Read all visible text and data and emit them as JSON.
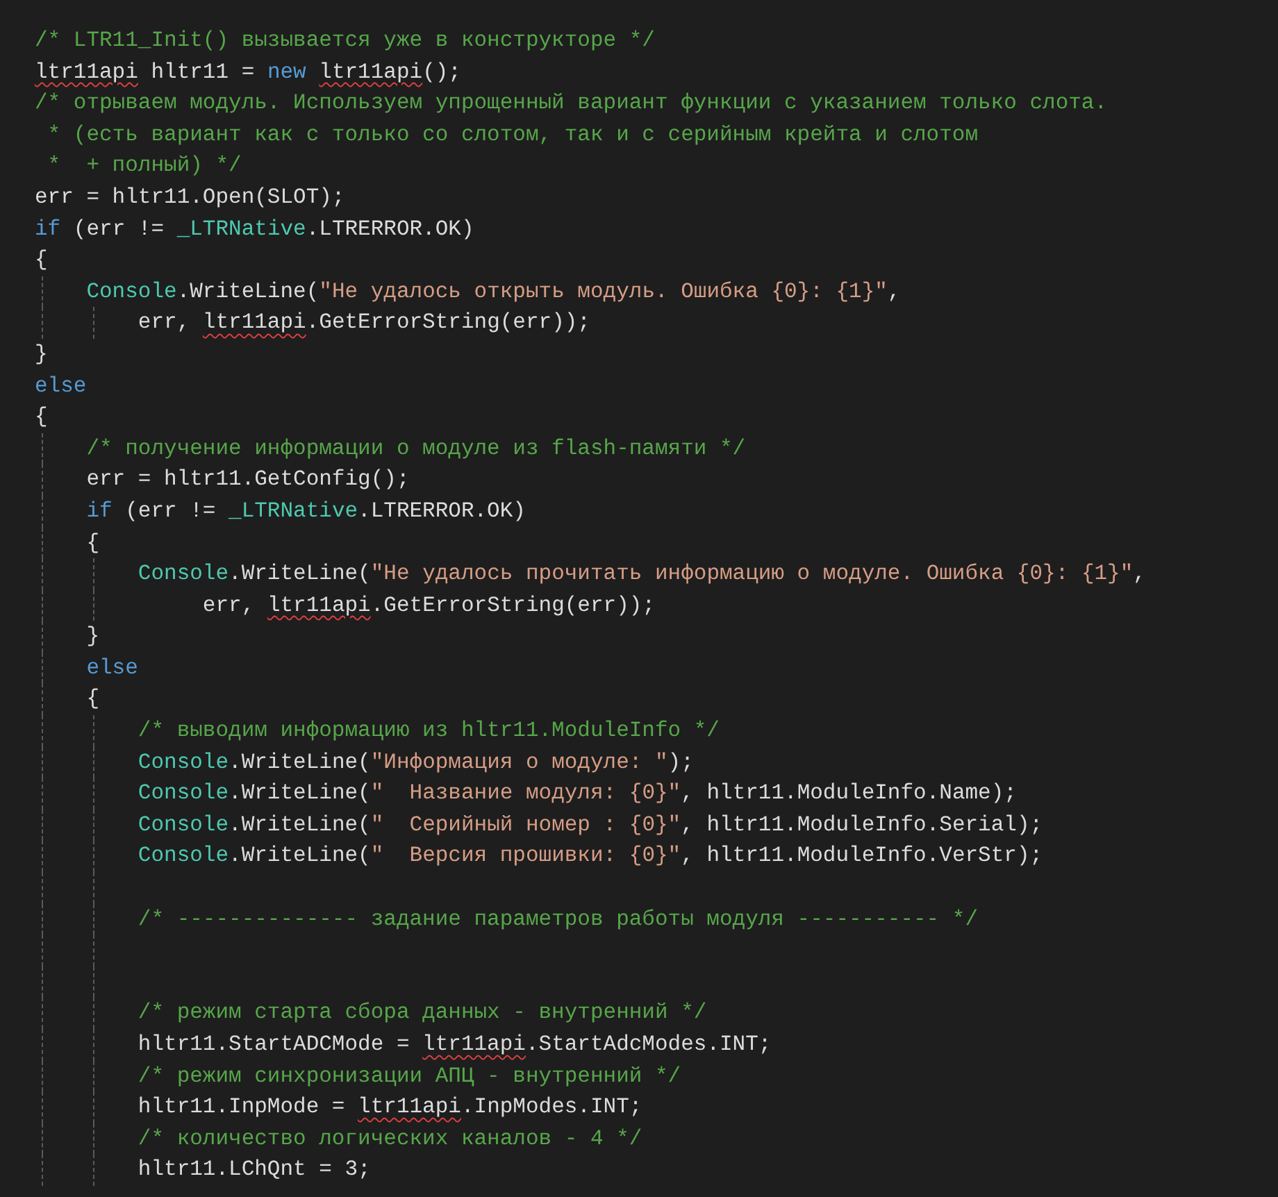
{
  "editor": {
    "lines": [
      {
        "kind": "code",
        "tokens": [
          {
            "kind": "comment",
            "text": "/* LTR11_Init() вызывается уже в конструкторе */"
          }
        ]
      },
      {
        "kind": "code",
        "tokens": [
          {
            "kind": "plain",
            "text": "ltr11api",
            "error": true
          },
          {
            "kind": "plain",
            "text": " hltr11 = "
          },
          {
            "kind": "keyword",
            "text": "new "
          },
          {
            "kind": "plain",
            "text": "ltr11api",
            "error": true
          },
          {
            "kind": "plain",
            "text": "();"
          }
        ]
      },
      {
        "kind": "code",
        "tokens": [
          {
            "kind": "comment",
            "text": "/* отрываем модуль. Используем упрощенный вариант функции с указанием только слота."
          }
        ]
      },
      {
        "kind": "code",
        "tokens": [
          {
            "kind": "comment",
            "text": " * (есть вариант как с только со слотом, так и с серийным крейта и слотом"
          }
        ]
      },
      {
        "kind": "code",
        "tokens": [
          {
            "kind": "comment",
            "text": " *  + полный) */"
          }
        ]
      },
      {
        "kind": "code",
        "tokens": [
          {
            "kind": "plain",
            "text": "err = hltr11.Open(SLOT);"
          }
        ]
      },
      {
        "kind": "code",
        "tokens": [
          {
            "kind": "keyword",
            "text": "if"
          },
          {
            "kind": "plain",
            "text": " (err != "
          },
          {
            "kind": "type",
            "text": "_LTRNative"
          },
          {
            "kind": "plain",
            "text": ".LTRERROR.OK)"
          }
        ]
      },
      {
        "kind": "code",
        "tokens": [
          {
            "kind": "plain",
            "text": "{"
          }
        ]
      },
      {
        "kind": "code",
        "tokens": [
          {
            "kind": "type",
            "text": "    Console"
          },
          {
            "kind": "plain",
            "text": ".WriteLine("
          },
          {
            "kind": "string",
            "text": "\"Не удалось открыть модуль. Ошибка {0}: {1}\""
          },
          {
            "kind": "plain",
            "text": ","
          }
        ]
      },
      {
        "kind": "code",
        "tokens": [
          {
            "kind": "plain",
            "text": "        err, "
          },
          {
            "kind": "plain",
            "text": "ltr11api",
            "error": true
          },
          {
            "kind": "plain",
            "text": ".GetErrorString(err));"
          }
        ]
      },
      {
        "kind": "code",
        "tokens": [
          {
            "kind": "plain",
            "text": "}"
          }
        ]
      },
      {
        "kind": "code",
        "tokens": [
          {
            "kind": "keyword",
            "text": "else"
          }
        ]
      },
      {
        "kind": "code",
        "tokens": [
          {
            "kind": "plain",
            "text": "{"
          }
        ]
      },
      {
        "kind": "code",
        "tokens": [
          {
            "kind": "comment",
            "text": "    /* получение информации о модуле из flash-памяти */"
          }
        ]
      },
      {
        "kind": "code",
        "tokens": [
          {
            "kind": "plain",
            "text": "    err = hltr11.GetConfig();"
          }
        ]
      },
      {
        "kind": "code",
        "tokens": [
          {
            "kind": "keyword",
            "text": "    if"
          },
          {
            "kind": "plain",
            "text": " (err != "
          },
          {
            "kind": "type",
            "text": "_LTRNative"
          },
          {
            "kind": "plain",
            "text": ".LTRERROR.OK)"
          }
        ]
      },
      {
        "kind": "code",
        "tokens": [
          {
            "kind": "plain",
            "text": "    {"
          }
        ]
      },
      {
        "kind": "code",
        "tokens": [
          {
            "kind": "type",
            "text": "        Console"
          },
          {
            "kind": "plain",
            "text": ".WriteLine("
          },
          {
            "kind": "string",
            "text": "\"Не удалось прочитать информацию о модуле. Ошибка {0}: {1}\""
          },
          {
            "kind": "plain",
            "text": ","
          }
        ]
      },
      {
        "kind": "code",
        "tokens": [
          {
            "kind": "plain",
            "text": "             err, "
          },
          {
            "kind": "plain",
            "text": "ltr11api",
            "error": true
          },
          {
            "kind": "plain",
            "text": ".GetErrorString(err));"
          }
        ]
      },
      {
        "kind": "code",
        "tokens": [
          {
            "kind": "plain",
            "text": "    }"
          }
        ]
      },
      {
        "kind": "code",
        "tokens": [
          {
            "kind": "keyword",
            "text": "    else"
          }
        ]
      },
      {
        "kind": "code",
        "tokens": [
          {
            "kind": "plain",
            "text": "    {"
          }
        ]
      },
      {
        "kind": "code",
        "tokens": [
          {
            "kind": "comment",
            "text": "        /* выводим информацию из hltr11.ModuleInfo */"
          }
        ]
      },
      {
        "kind": "code",
        "tokens": [
          {
            "kind": "type",
            "text": "        Console"
          },
          {
            "kind": "plain",
            "text": ".WriteLine("
          },
          {
            "kind": "string",
            "text": "\"Информация о модуле: \""
          },
          {
            "kind": "plain",
            "text": ");"
          }
        ]
      },
      {
        "kind": "code",
        "tokens": [
          {
            "kind": "type",
            "text": "        Console"
          },
          {
            "kind": "plain",
            "text": ".WriteLine("
          },
          {
            "kind": "string",
            "text": "\"  Название модуля: {0}\""
          },
          {
            "kind": "plain",
            "text": ", hltr11.ModuleInfo.Name);"
          }
        ]
      },
      {
        "kind": "code",
        "tokens": [
          {
            "kind": "type",
            "text": "        Console"
          },
          {
            "kind": "plain",
            "text": ".WriteLine("
          },
          {
            "kind": "string",
            "text": "\"  Серийный номер : {0}\""
          },
          {
            "kind": "plain",
            "text": ", hltr11.ModuleInfo.Serial);"
          }
        ]
      },
      {
        "kind": "code",
        "tokens": [
          {
            "kind": "type",
            "text": "        Console"
          },
          {
            "kind": "plain",
            "text": ".WriteLine("
          },
          {
            "kind": "string",
            "text": "\"  Версия прошивки: {0}\""
          },
          {
            "kind": "plain",
            "text": ", hltr11.ModuleInfo.VerStr);"
          }
        ]
      },
      {
        "kind": "blank"
      },
      {
        "kind": "code",
        "tokens": [
          {
            "kind": "comment",
            "text": "        /* -------------- задание параметров работы модуля ----------- */"
          }
        ]
      },
      {
        "kind": "blank"
      },
      {
        "kind": "blank"
      },
      {
        "kind": "code",
        "tokens": [
          {
            "kind": "comment",
            "text": "        /* режим старта сбора данных - внутренний */"
          }
        ]
      },
      {
        "kind": "code",
        "tokens": [
          {
            "kind": "plain",
            "text": "        hltr11.StartADCMode = "
          },
          {
            "kind": "plain",
            "text": "ltr11api",
            "error": true
          },
          {
            "kind": "plain",
            "text": ".StartAdcModes.INT;"
          }
        ]
      },
      {
        "kind": "code",
        "tokens": [
          {
            "kind": "comment",
            "text": "        /* режим синхронизации АПЦ - внутренний */"
          }
        ]
      },
      {
        "kind": "code",
        "tokens": [
          {
            "kind": "plain",
            "text": "        hltr11.InpMode = "
          },
          {
            "kind": "plain",
            "text": "ltr11api",
            "error": true
          },
          {
            "kind": "plain",
            "text": ".InpModes.INT;"
          }
        ]
      },
      {
        "kind": "code",
        "tokens": [
          {
            "kind": "comment",
            "text": "        /* количество логических каналов - 4 */"
          }
        ]
      },
      {
        "kind": "code",
        "tokens": [
          {
            "kind": "plain",
            "text": "        hltr11.LChQnt = 3;"
          }
        ]
      }
    ]
  }
}
